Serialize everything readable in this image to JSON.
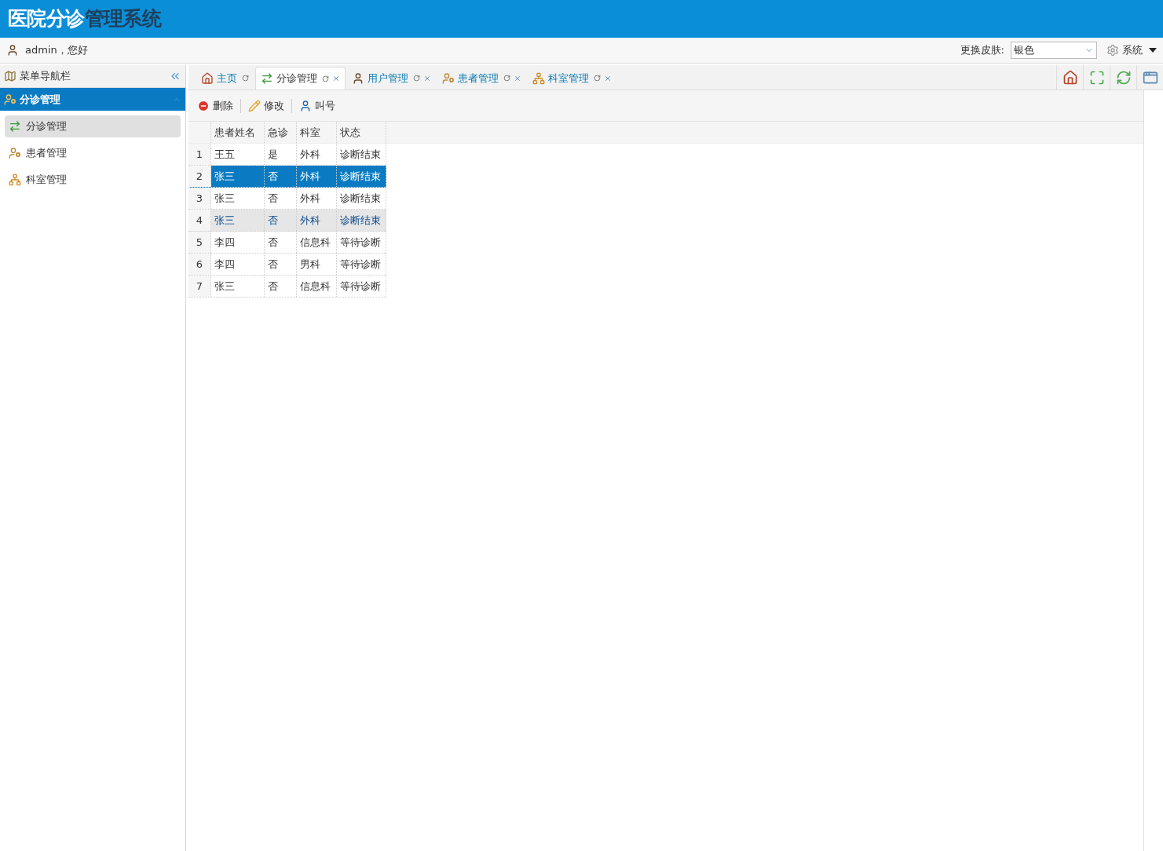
{
  "header": {
    "title_main": "医院分诊",
    "title_sub": "管理系统"
  },
  "user_bar": {
    "greeting": "admin，您好",
    "skin_label": "更换皮肤:",
    "skin_value": "银色",
    "system_menu": "系统"
  },
  "sidebar": {
    "title": "菜单导航栏",
    "groups": [
      {
        "label": "分诊管理",
        "expanded": true,
        "items": [
          {
            "label": "分诊管理",
            "kind": "triage",
            "selected": true
          },
          {
            "label": "患者管理",
            "kind": "patient",
            "selected": false
          },
          {
            "label": "科室管理",
            "kind": "dept",
            "selected": false
          }
        ]
      }
    ]
  },
  "tabs": [
    {
      "label": "主页",
      "kind": "home",
      "selected": false,
      "closable": false
    },
    {
      "label": "分诊管理",
      "kind": "triage",
      "selected": true,
      "closable": true
    },
    {
      "label": "用户管理",
      "kind": "user",
      "selected": false,
      "closable": true
    },
    {
      "label": "患者管理",
      "kind": "patient",
      "selected": false,
      "closable": true
    },
    {
      "label": "科室管理",
      "kind": "dept",
      "selected": false,
      "closable": true
    }
  ],
  "toolbar": [
    {
      "label": "删除",
      "kind": "delete"
    },
    {
      "label": "修改",
      "kind": "edit"
    },
    {
      "label": "叫号",
      "kind": "call"
    }
  ],
  "table": {
    "columns": [
      "患者姓名",
      "急诊",
      "科室",
      "状态"
    ],
    "rows": [
      {
        "index": "1",
        "cells": [
          "王五",
          "是",
          "外科",
          "诊断结束"
        ],
        "selected": false,
        "hovered": false
      },
      {
        "index": "2",
        "cells": [
          "张三",
          "否",
          "外科",
          "诊断结束"
        ],
        "selected": true,
        "hovered": false
      },
      {
        "index": "3",
        "cells": [
          "张三",
          "否",
          "外科",
          "诊断结束"
        ],
        "selected": false,
        "hovered": false
      },
      {
        "index": "4",
        "cells": [
          "张三",
          "否",
          "外科",
          "诊断结束"
        ],
        "selected": false,
        "hovered": true
      },
      {
        "index": "5",
        "cells": [
          "李四",
          "否",
          "信息科",
          "等待诊断"
        ],
        "selected": false,
        "hovered": false
      },
      {
        "index": "6",
        "cells": [
          "李四",
          "否",
          "男科",
          "等待诊断"
        ],
        "selected": false,
        "hovered": false
      },
      {
        "index": "7",
        "cells": [
          "张三",
          "否",
          "信息科",
          "等待诊断"
        ],
        "selected": false,
        "hovered": false
      }
    ]
  }
}
